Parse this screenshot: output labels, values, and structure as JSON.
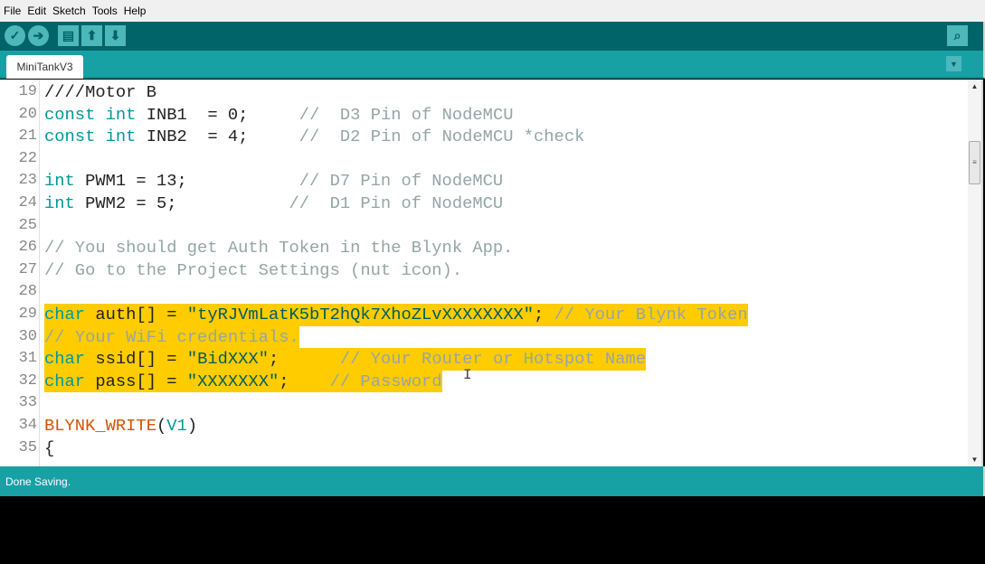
{
  "menu": [
    "File",
    "Edit",
    "Sketch",
    "Tools",
    "Help"
  ],
  "toolbar": {
    "buttons": [
      {
        "name": "verify-button",
        "icon": "check-icon",
        "glyph": "✓"
      },
      {
        "name": "upload-button",
        "icon": "arrow-right-icon",
        "glyph": "➔"
      },
      {
        "name": "new-button",
        "icon": "document-icon",
        "glyph": "▤"
      },
      {
        "name": "open-button",
        "icon": "arrow-up-icon",
        "glyph": "⬆"
      },
      {
        "name": "save-button",
        "icon": "arrow-down-icon",
        "glyph": "⬇"
      }
    ],
    "serial_monitor_icon": "magnifier-icon"
  },
  "tab": {
    "label": "MiniTankV3"
  },
  "editor": {
    "first_line": 19,
    "lines": [
      {
        "n": "19",
        "tokens": [
          [
            "////Motor B",
            ""
          ]
        ]
      },
      {
        "n": "20",
        "tokens": [
          [
            "const",
            "kw"
          ],
          [
            " ",
            ""
          ],
          [
            "int",
            "kw"
          ],
          [
            " INB1  = 0;     ",
            ""
          ],
          [
            "//  D3 Pin of NodeMCU",
            "cm"
          ]
        ]
      },
      {
        "n": "21",
        "tokens": [
          [
            "const",
            "kw"
          ],
          [
            " ",
            ""
          ],
          [
            "int",
            "kw"
          ],
          [
            " INB2  = 4;     ",
            ""
          ],
          [
            "//  D2 Pin of NodeMCU *check",
            "cm"
          ]
        ]
      },
      {
        "n": "22",
        "tokens": []
      },
      {
        "n": "23",
        "tokens": [
          [
            "int",
            "kw"
          ],
          [
            " PWM1 = 13;           ",
            ""
          ],
          [
            "// D7 Pin of NodeMCU",
            "cm"
          ]
        ]
      },
      {
        "n": "24",
        "tokens": [
          [
            "int",
            "kw"
          ],
          [
            " PWM2 = 5;           ",
            ""
          ],
          [
            "//  D1 Pin of NodeMCU",
            "cm"
          ]
        ]
      },
      {
        "n": "25",
        "tokens": []
      },
      {
        "n": "26",
        "tokens": [
          [
            "// You should get Auth Token in the Blynk App.",
            "cm"
          ]
        ]
      },
      {
        "n": "27",
        "tokens": [
          [
            "// Go to the Project Settings (nut icon).",
            "cm"
          ]
        ]
      },
      {
        "n": "28",
        "tokens": []
      },
      {
        "n": "29",
        "sel": true,
        "tokens": [
          [
            "char",
            "kw"
          ],
          [
            " auth[] = ",
            ""
          ],
          [
            "\"tyRJVmLatK5bT2hQk7XhoZLvXXXXXXXX\"",
            "str"
          ],
          [
            "; ",
            ""
          ],
          [
            "// Your Blynk Token",
            "cm"
          ]
        ]
      },
      {
        "n": "30",
        "sel": true,
        "tokens": [
          [
            "// Your WiFi credentials.",
            "cm"
          ]
        ]
      },
      {
        "n": "31",
        "sel": true,
        "tokens": [
          [
            "char",
            "kw"
          ],
          [
            " ssid[] = ",
            ""
          ],
          [
            "\"BidXXX\"",
            "str"
          ],
          [
            ";      ",
            ""
          ],
          [
            "// Your Router or Hotspot Name",
            "cm"
          ]
        ]
      },
      {
        "n": "32",
        "sel": true,
        "tokens": [
          [
            "char",
            "kw"
          ],
          [
            " pass[] = ",
            ""
          ],
          [
            "\"XXXXXXX\"",
            "str"
          ],
          [
            ";    ",
            ""
          ],
          [
            "// Password",
            "cm"
          ]
        ]
      },
      {
        "n": "33",
        "tokens": []
      },
      {
        "n": "34",
        "tokens": [
          [
            "BLYNK_WRITE",
            "fn"
          ],
          [
            "(",
            ""
          ],
          [
            "V1",
            "kw"
          ],
          [
            ")",
            ""
          ]
        ]
      },
      {
        "n": "35",
        "tokens": [
          [
            "{",
            ""
          ]
        ]
      }
    ]
  },
  "status": {
    "text": "Done Saving."
  },
  "colors": {
    "toolbar": "#006468",
    "tabbar": "#17a1a5",
    "selection": "#ffcc00",
    "keyword": "#00979c",
    "function": "#d35400",
    "string": "#005c5f",
    "comment": "#95a5a6"
  }
}
